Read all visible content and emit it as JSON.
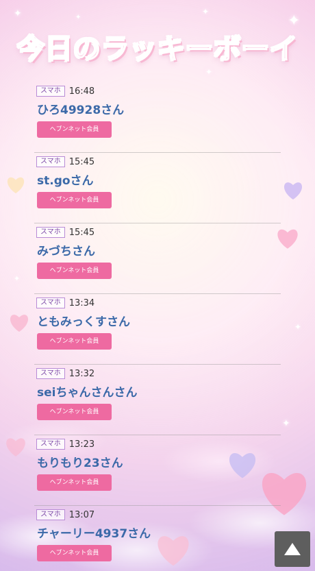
{
  "header": {
    "title": "今日のラッキーボーイ"
  },
  "entries": [
    {
      "device": "スマホ",
      "time": "16:48",
      "name": "ひろ49928さん",
      "badge": "ヘブンネット会員"
    },
    {
      "device": "スマホ",
      "time": "15:45",
      "name": "st.goさん",
      "badge": "ヘブンネット会員"
    },
    {
      "device": "スマホ",
      "time": "15:45",
      "name": "みづちさん",
      "badge": "ヘブンネット会員"
    },
    {
      "device": "スマホ",
      "time": "13:34",
      "name": "ともみっくすさん",
      "badge": "ヘブンネット会員"
    },
    {
      "device": "スマホ",
      "time": "13:32",
      "name": "seiちゃんさんさん",
      "badge": "ヘブンネット会員"
    },
    {
      "device": "スマホ",
      "time": "13:23",
      "name": "もりもり23さん",
      "badge": "ヘブンネット会員"
    },
    {
      "device": "スマホ",
      "time": "13:07",
      "name": "チャーリー4937さん",
      "badge": "ヘブンネット会員"
    }
  ],
  "scroll_top": {
    "icon": "triangle-up-icon"
  },
  "colors": {
    "accent": "#ee6aa1",
    "name_text": "#3b69a8",
    "title": "#f36aa8"
  }
}
